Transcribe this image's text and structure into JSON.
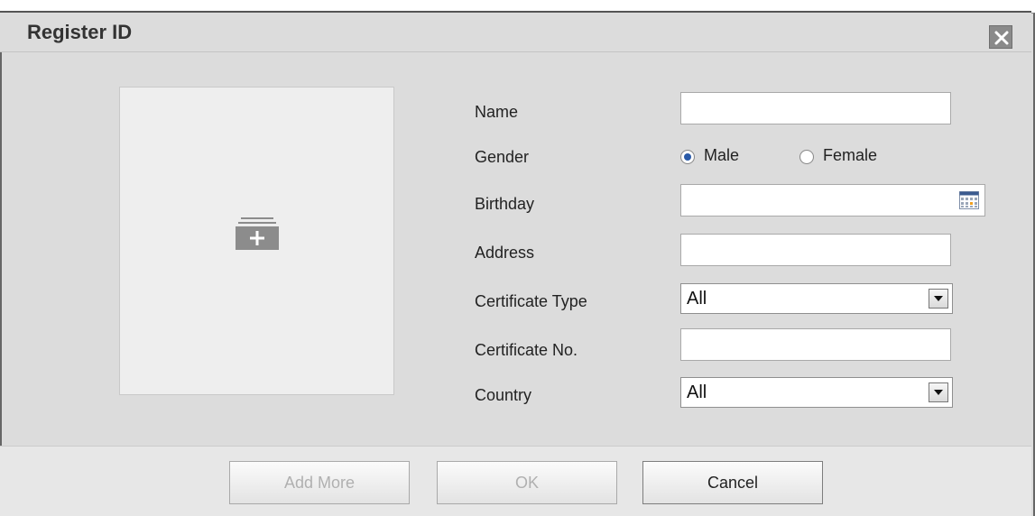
{
  "dialog": {
    "title": "Register ID",
    "close_icon": "close-icon"
  },
  "photo": {
    "icon": "add-photo-icon"
  },
  "form": {
    "name_label": "Name",
    "name_value": "",
    "gender_label": "Gender",
    "gender_options": [
      "Male",
      "Female"
    ],
    "gender_selected": "Male",
    "birthday_label": "Birthday",
    "birthday_value": "",
    "birthday_icon": "calendar-icon",
    "address_label": "Address",
    "address_value": "",
    "certificate_type_label": "Certificate Type",
    "certificate_type_value": "All",
    "certificate_no_label": "Certificate No.",
    "certificate_no_value": "",
    "country_label": "Country",
    "country_value": "All"
  },
  "footer": {
    "add_more_label": "Add More",
    "ok_label": "OK",
    "cancel_label": "Cancel"
  },
  "colors": {
    "background": "#dcdcdc",
    "radio_accent": "#2a5aa8",
    "disabled_text": "#b0b0b0"
  }
}
